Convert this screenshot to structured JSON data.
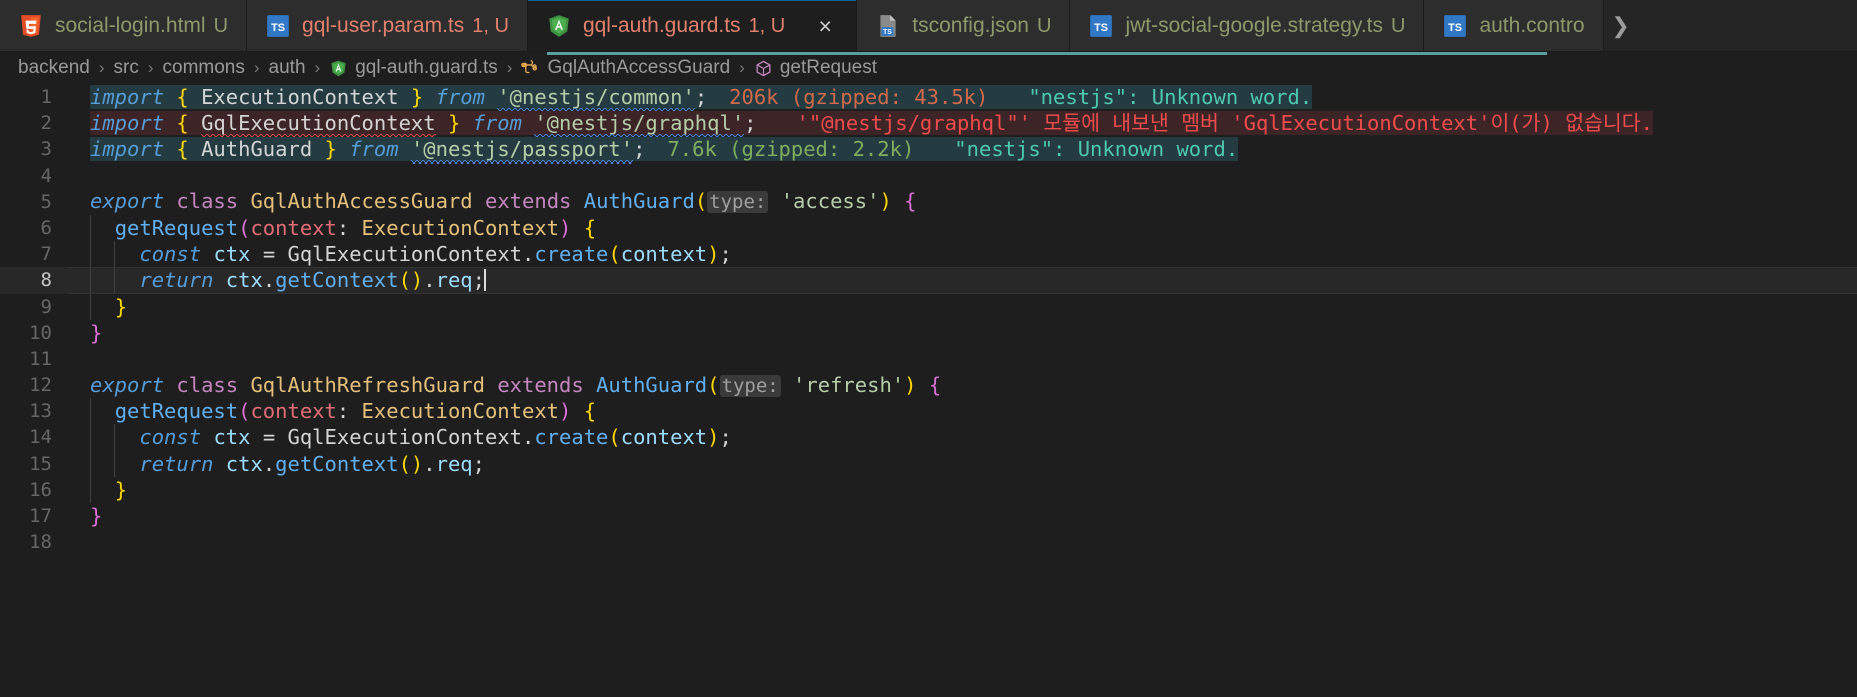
{
  "window": {
    "app": "Visual Studio Code"
  },
  "tabs": [
    {
      "label": "social-login.html",
      "icon": "html5-icon",
      "badge": "U",
      "state": "plain",
      "active": false,
      "closable": false
    },
    {
      "label": "gql-user.param.ts",
      "icon": "typescript-icon",
      "badge": "1, U",
      "state": "modified",
      "active": false,
      "closable": false
    },
    {
      "label": "gql-auth.guard.ts",
      "icon": "angular-icon",
      "badge": "1, U",
      "state": "modified",
      "active": true,
      "closable": true,
      "close_label": "×"
    },
    {
      "label": "tsconfig.json",
      "icon": "tsconfig-icon",
      "badge": "U",
      "state": "plain",
      "active": false,
      "closable": false
    },
    {
      "label": "jwt-social-google.strategy.ts",
      "icon": "typescript-icon",
      "badge": "U",
      "state": "plain",
      "active": false,
      "closable": false
    },
    {
      "label": "auth.contro",
      "icon": "typescript-icon",
      "badge": "",
      "state": "plain",
      "active": false,
      "closable": false
    }
  ],
  "tabbar": {
    "overflow_chevron": "❯"
  },
  "breadcrumb": {
    "separator": "›",
    "items": [
      {
        "label": "backend",
        "icon": ""
      },
      {
        "label": "src",
        "icon": ""
      },
      {
        "label": "commons",
        "icon": ""
      },
      {
        "label": "auth",
        "icon": ""
      },
      {
        "label": "gql-auth.guard.ts",
        "icon": "angular-icon"
      },
      {
        "label": "GqlAuthAccessGuard",
        "icon": "class-icon"
      },
      {
        "label": "getRequest",
        "icon": "method-icon"
      }
    ]
  },
  "editor": {
    "filename": "gql-auth.guard.ts",
    "language": "typescript",
    "cursor_line": 8,
    "line_numbers": [
      "1",
      "2",
      "3",
      "4",
      "5",
      "6",
      "7",
      "8",
      "9",
      "10",
      "11",
      "12",
      "13",
      "14",
      "15",
      "16",
      "17",
      "18"
    ],
    "lines": {
      "l1": {
        "text": "import { ExecutionContext } from '@nestjs/common';",
        "module": "'@nestjs/common'"
      },
      "l2": {
        "text": "import { GqlExecutionContext } from '@nestjs/graphql';",
        "module": "'@nestjs/graphql'"
      },
      "l3": {
        "text": "import { AuthGuard } from '@nestjs/passport';",
        "module": "'@nestjs/passport'"
      },
      "l5": {
        "text": "export class GqlAuthAccessGuard extends AuthGuard(type: 'access') {"
      },
      "l6": {
        "text": "getRequest(context: ExecutionContext) {"
      },
      "l7": {
        "text": "const ctx = GqlExecutionContext.create(context);"
      },
      "l8": {
        "text": "return ctx.getContext().req;"
      },
      "l12": {
        "text": "export class GqlAuthRefreshGuard extends AuthGuard(type: 'refresh') {"
      }
    },
    "tokens": {
      "import": "import",
      "from": "from",
      "export": "export",
      "class": "class",
      "extends": "extends",
      "const": "const",
      "return": "return",
      "brace_open": "{",
      "brace_close": "}",
      "paren_open": "(",
      "paren_close": ")",
      "semi": ";",
      "colon": ":",
      "dot": ".",
      "equals": "=",
      "ExecutionContext": "ExecutionContext",
      "GqlExecutionContext": "GqlExecutionContext",
      "AuthGuard": "AuthGuard",
      "GqlAuthAccessGuard": "GqlAuthAccessGuard",
      "GqlAuthRefreshGuard": "GqlAuthRefreshGuard",
      "getRequest": "getRequest",
      "context": "context",
      "ctx": "ctx",
      "create": "create",
      "getContext": "getContext",
      "req": "req",
      "mod_common": "'@nestjs/common'",
      "mod_graphql": "'@nestjs/graphql'",
      "mod_passport": "'@nestjs/passport'",
      "access_str": "'access'",
      "refresh_str": "'refresh'",
      "inlay_type": "type:"
    },
    "inlay_hints": {
      "line1_size": "206k (gzipped: 43.5k)",
      "line1_spell": "\"nestjs\": Unknown word.",
      "line2_error": "'\"@nestjs/graphql\"' 모듈에 내보낸 멤버 'GqlExecutionContext'이(가) 없습니다.",
      "line3_size": "7.6k (gzipped: 2.2k)",
      "line3_spell": "\"nestjs\": Unknown word."
    }
  },
  "colors": {
    "editor_bg": "#1e1e1e",
    "tabbar_bg": "#252526",
    "tab_active_bg": "#1e1e1e",
    "tab_inactive_bg": "#2d2d2d",
    "find_highlight": "#243b42",
    "error_line": "#3d2427",
    "accent_teal": "#5a9e9e",
    "keyword": "#569cd6",
    "string": "#b5cea8",
    "type": "#4ec9b0",
    "error_red": "#f14c4c"
  }
}
